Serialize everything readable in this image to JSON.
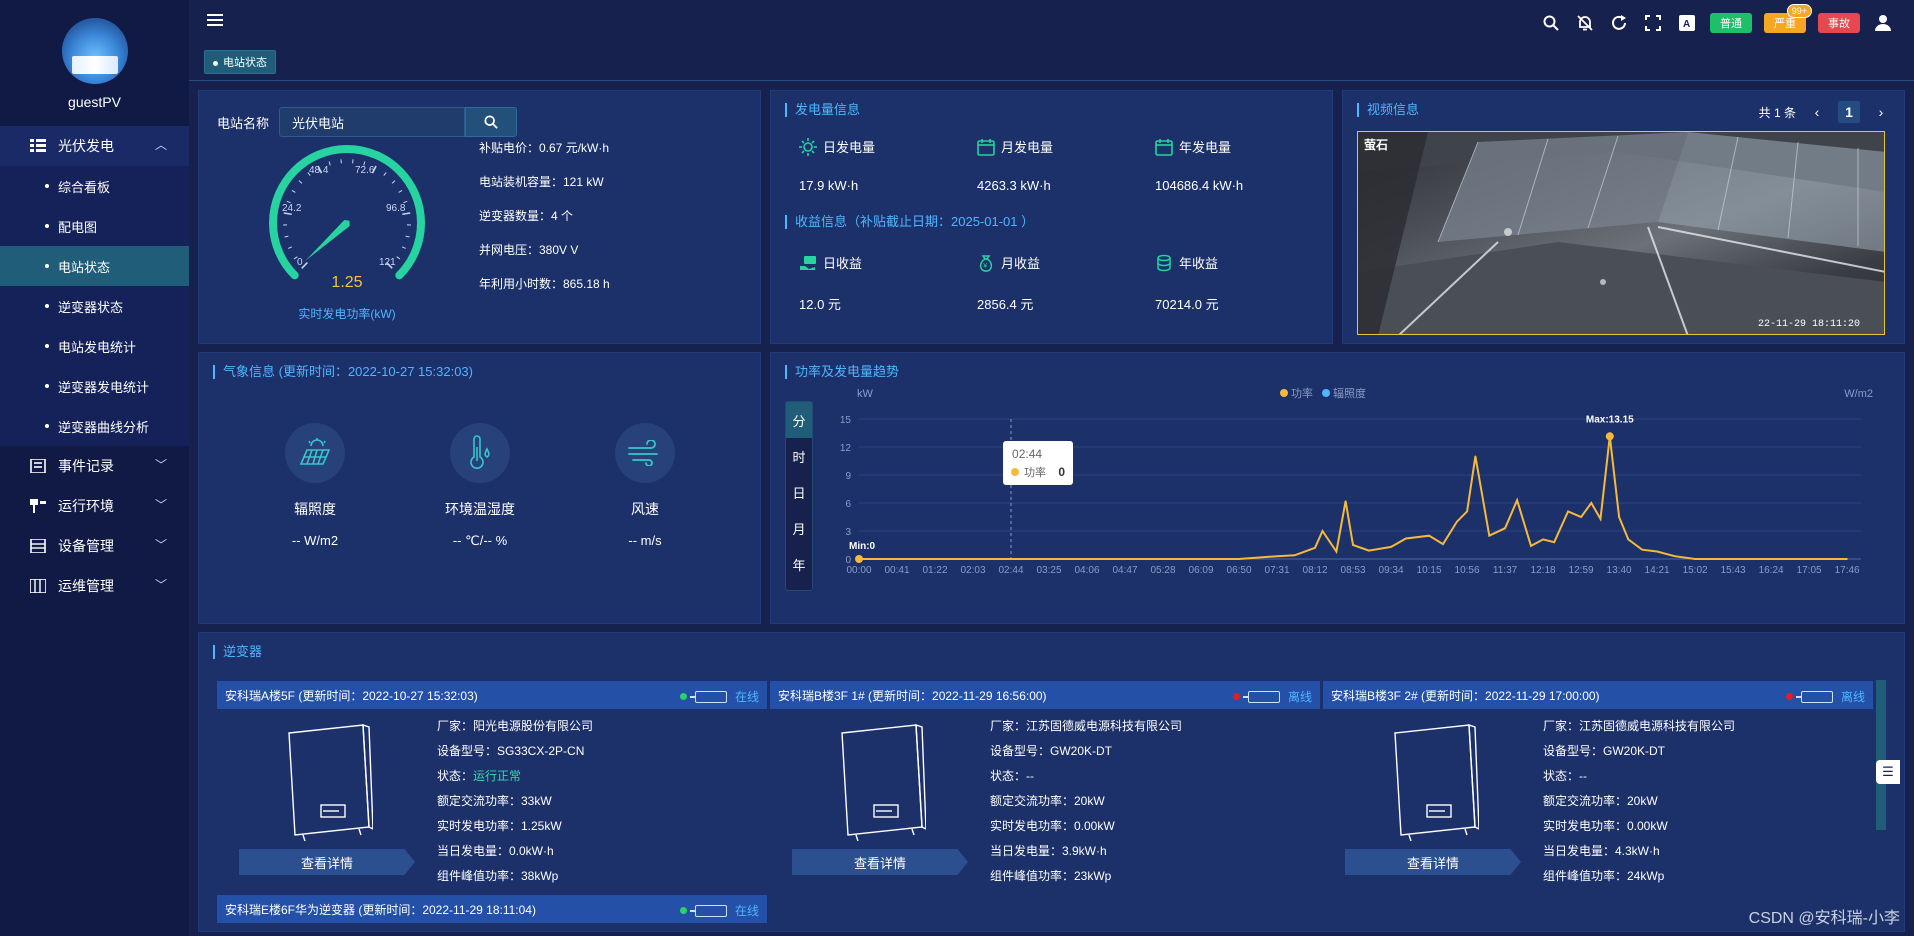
{
  "sidebar": {
    "username": "guestPV",
    "items": [
      {
        "label": "光伏发电",
        "icon": "grid-icon"
      },
      {
        "label": "事件记录",
        "icon": "document-icon"
      },
      {
        "label": "运行环境",
        "icon": "tools-icon"
      },
      {
        "label": "设备管理",
        "icon": "device-icon"
      },
      {
        "label": "运维管理",
        "icon": "maintenance-icon"
      }
    ],
    "sub_items": [
      "综合看板",
      "配电图",
      "电站状态",
      "逆变器状态",
      "电站发电统计",
      "逆变器发电统计",
      "逆变器曲线分析"
    ],
    "active_sub": "电站状态"
  },
  "topbar": {
    "badges": {
      "normal": "普通",
      "serious": "严重",
      "serious_count": "99+",
      "accident": "事故"
    }
  },
  "tabs": {
    "current": "电站状态"
  },
  "station": {
    "name_label": "电站名称",
    "name_value": "光伏电站",
    "gauge_value": "1.25",
    "gauge_label": "实时发电功率(kW)",
    "gauge_ticks": [
      "0",
      "24.2",
      "48.4",
      "72.6",
      "96.8",
      "121"
    ],
    "gauge_fraction": 0.0103,
    "specs": [
      "补贴电价：0.67 元/kW·h",
      "电站装机容量：121 kW",
      "逆变器数量：4 个",
      "并网电压：380V V",
      "年利用小时数：865.18 h"
    ]
  },
  "generation": {
    "title": "发电量信息",
    "items": [
      {
        "label": "日发电量",
        "value": "17.9 kW·h"
      },
      {
        "label": "月发电量",
        "value": "4263.3 kW·h"
      },
      {
        "label": "年发电量",
        "value": "104686.4 kW·h"
      }
    ],
    "income_title": "收益信息（补贴截止日期：2025-01-01 ）",
    "income": [
      {
        "label": "日收益",
        "value": "12.0 元"
      },
      {
        "label": "月收益",
        "value": "2856.4 元"
      },
      {
        "label": "年收益",
        "value": "70214.0 元"
      }
    ]
  },
  "video": {
    "title": "视频信息",
    "total": "共 1 条",
    "page": "1",
    "timestamp": "22-11-29 18:11:20",
    "brand": "萤石"
  },
  "weather": {
    "title": "气象信息 (更新时间：2022-10-27 15:32:03)",
    "items": [
      {
        "name": "辐照度",
        "value": "-- W/m2"
      },
      {
        "name": "环境温湿度",
        "value": "-- ℃/-- %"
      },
      {
        "name": "风速",
        "value": "-- m/s"
      }
    ]
  },
  "trend": {
    "title": "功率及发电量趋势",
    "periods": [
      "分",
      "时",
      "日",
      "月",
      "年"
    ],
    "tooltip_time": "02:44",
    "tooltip_label": "功率",
    "tooltip_value": "0",
    "max_label": "Max:13.15",
    "min_label": "Min:0"
  },
  "chart_data": {
    "type": "line",
    "title": "",
    "xlabel": "",
    "ylabel": "kW",
    "y2label": "W/m2",
    "ylim": [
      0,
      15
    ],
    "yticks": [
      0,
      3,
      6,
      9,
      12,
      15
    ],
    "legend": [
      "功率",
      "辐照度"
    ],
    "legend_position": "top-center",
    "x_ticks": [
      "00:00",
      "00:41",
      "01:22",
      "02:03",
      "02:44",
      "03:25",
      "04:06",
      "04:47",
      "05:28",
      "06:09",
      "06:50",
      "07:31",
      "08:12",
      "08:53",
      "09:34",
      "10:15",
      "10:56",
      "11:37",
      "12:18",
      "12:59",
      "13:40",
      "14:21",
      "15:02",
      "15:43",
      "16:24",
      "17:05",
      "17:46"
    ],
    "series": [
      {
        "name": "功率",
        "color": "#f6b93b",
        "x": [
          "00:00",
          "06:50",
          "07:31",
          "07:50",
          "08:12",
          "08:20",
          "08:35",
          "08:45",
          "08:53",
          "09:10",
          "09:34",
          "09:50",
          "10:15",
          "10:30",
          "10:45",
          "10:56",
          "11:05",
          "11:20",
          "11:37",
          "11:50",
          "12:05",
          "12:18",
          "12:30",
          "12:45",
          "12:59",
          "13:10",
          "13:20",
          "13:30",
          "13:40",
          "13:50",
          "14:05",
          "14:21",
          "14:40",
          "15:02",
          "17:46"
        ],
        "values": [
          0,
          0,
          0.3,
          0.4,
          1.2,
          3.0,
          0.8,
          6.2,
          1.5,
          0.9,
          1.3,
          2.2,
          2.5,
          1.6,
          4.0,
          5.1,
          11.0,
          2.5,
          3.3,
          6.3,
          1.4,
          2.1,
          1.8,
          5.1,
          4.5,
          6.0,
          4.3,
          13.15,
          4.5,
          2.1,
          1.0,
          0.8,
          0.3,
          0,
          0
        ]
      }
    ]
  },
  "inverters": {
    "title": "逆变器",
    "cards": [
      {
        "title": "安科瑞A楼5F (更新时间：2022-10-27 15:32:03)",
        "status": "在线",
        "online": true,
        "maker": "厂家：阳光电源股份有限公司",
        "model": "设备型号：SG33CX-2P-CN",
        "state_label": "状态：",
        "state": "运行正常",
        "rated": "额定交流功率：33kW",
        "realtime": "实时发电功率：1.25kW",
        "daily": "当日发电量：0.0kW·h",
        "peak": "组件峰值功率：38kWp",
        "detail": "查看详情"
      },
      {
        "title": "安科瑞B楼3F 1# (更新时间：2022-11-29 16:56:00)",
        "status": "离线",
        "online": false,
        "maker": "厂家：江苏固德威电源科技有限公司",
        "model": "设备型号：GW20K-DT",
        "state_label": "状态：",
        "state": "--",
        "rated": "额定交流功率：20kW",
        "realtime": "实时发电功率：0.00kW",
        "daily": "当日发电量：3.9kW·h",
        "peak": "组件峰值功率：23kWp",
        "detail": "查看详情"
      },
      {
        "title": "安科瑞B楼3F 2# (更新时间：2022-11-29 17:00:00)",
        "status": "离线",
        "online": false,
        "maker": "厂家：江苏固德威电源科技有限公司",
        "model": "设备型号：GW20K-DT",
        "state_label": "状态：",
        "state": "--",
        "rated": "额定交流功率：20kW",
        "realtime": "实时发电功率：0.00kW",
        "daily": "当日发电量：4.3kW·h",
        "peak": "组件峰值功率：24kWp",
        "detail": "查看详情"
      },
      {
        "title": "安科瑞E楼6F华为逆变器 (更新时间：2022-11-29 18:11:04)",
        "status": "在线",
        "online": true
      }
    ]
  },
  "watermark": "CSDN @安科瑞-小李",
  "colors": {
    "accent": "#4fb6ff",
    "gauge": "#27d3a0",
    "online": "#27d36a",
    "offline": "#e02020",
    "line": "#f6b93b"
  }
}
